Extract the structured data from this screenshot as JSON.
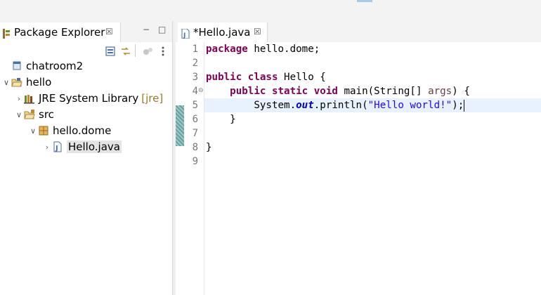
{
  "package_explorer": {
    "tab_label": "Package Explorer",
    "close_glyph": "☒",
    "minimize_glyph": "−",
    "maximize_glyph": "□",
    "tree": [
      {
        "label": "chatroom2",
        "icon": "project-icon"
      },
      {
        "label": "hello",
        "icon": "open-project-icon",
        "arrow": "∨"
      },
      {
        "label": "JRE System Library",
        "decoration": "[jre]",
        "icon": "library-icon",
        "arrow": "›"
      },
      {
        "label": "src",
        "icon": "source-folder-icon",
        "arrow": "∨"
      },
      {
        "label": "hello.dome",
        "icon": "package-icon",
        "arrow": "∨"
      },
      {
        "label": "Hello.java",
        "icon": "java-file-icon",
        "arrow": "›",
        "selected": true
      }
    ]
  },
  "editor": {
    "tab_label": "*Hello.java",
    "close_glyph": "☒",
    "line_numbers": [
      "1",
      "2",
      "3",
      "4",
      "5",
      "6",
      "7",
      "8",
      "9"
    ],
    "code": {
      "l1_kw": "package",
      "l1_rest": " hello.dome;",
      "l3_kw1": "public",
      "l3_kw2": "class",
      "l3_rest": " Hello {",
      "l4_indent": "    ",
      "l4_kw1": "public",
      "l4_kw2": "static",
      "l4_kw3": "void",
      "l4_mid": " main(String[] ",
      "l4_param": "args",
      "l4_end": ") {",
      "l5_indent": "        System.",
      "l5_field": "out",
      "l5_mid": ".println(",
      "l5_str": "\"Hello world!\"",
      "l5_end": ");",
      "l6": "    }",
      "l8": "}"
    }
  },
  "colors": {
    "keyword": "#7f0055",
    "string": "#2a00ff",
    "field": "#0000c0",
    "current_line": "#e8f2fe"
  }
}
